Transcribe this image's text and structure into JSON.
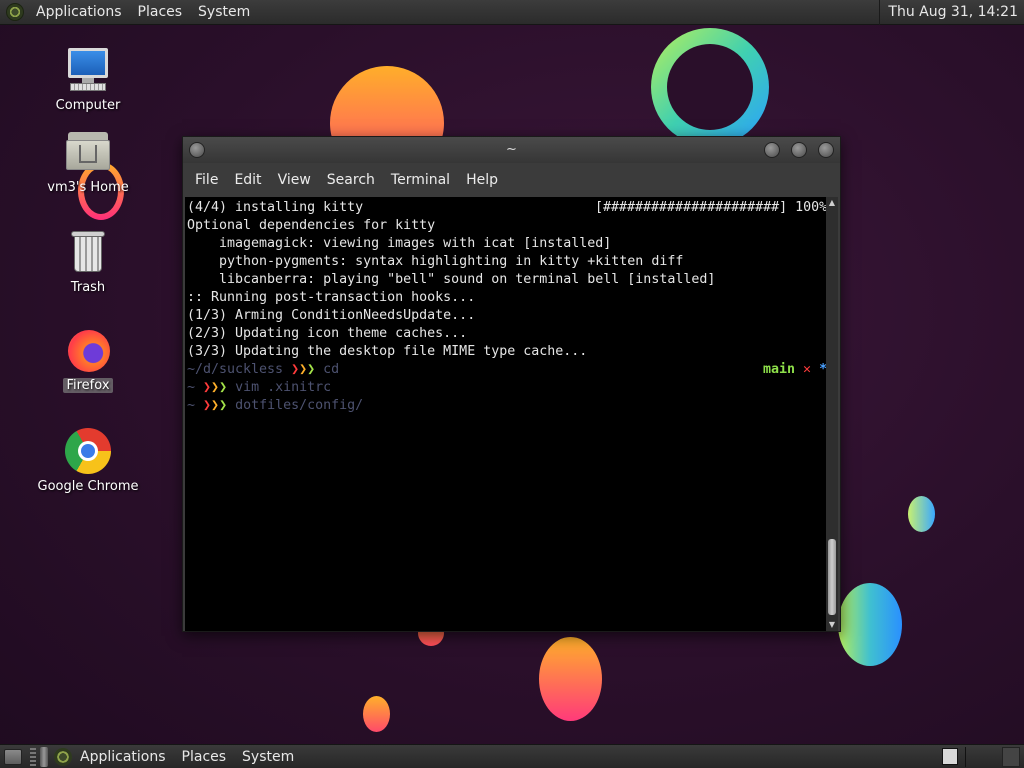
{
  "top_panel": {
    "menu": [
      "Applications",
      "Places",
      "System"
    ],
    "clock": "Thu Aug 31, 14:21"
  },
  "bottom_panel": {
    "menu": [
      "Applications",
      "Places",
      "System"
    ]
  },
  "desktop_icons": [
    {
      "label": "Computer",
      "icon": "computer-icon"
    },
    {
      "label": "vm3's Home",
      "icon": "home-folder-icon"
    },
    {
      "label": "Trash",
      "icon": "trash-icon"
    },
    {
      "label": "Firefox",
      "icon": "firefox-icon",
      "selected": true
    },
    {
      "label": "Google Chrome",
      "icon": "chrome-icon"
    }
  ],
  "terminal": {
    "title": "~",
    "menu": [
      "File",
      "Edit",
      "View",
      "Search",
      "Terminal",
      "Help"
    ],
    "lines": [
      "(4/4) installing kitty",
      "Optional dependencies for kitty",
      "    imagemagick: viewing images with icat [installed]",
      "    python-pygments: syntax highlighting in kitty +kitten diff",
      "    libcanberra: playing \"bell\" sound on terminal bell [installed]",
      ":: Running post-transaction hooks...",
      "(1/3) Arming ConditionNeedsUpdate...",
      "(2/3) Updating icon theme caches...",
      "(3/3) Updating the desktop file MIME type cache..."
    ],
    "progress": "[######################] 100%",
    "progress_value": 100,
    "prompts": [
      {
        "path": "~/d/suckless",
        "command": "cd"
      },
      {
        "path": "~",
        "command": "vim .xinitrc"
      },
      {
        "path": "~",
        "command": "dotfiles/config/"
      }
    ],
    "prompt_symbol": "❯",
    "git": {
      "branch": "main",
      "dirty_mark": "✕",
      "star": "*"
    }
  },
  "colors": {
    "chevron_red": "#ff3b3b",
    "chevron_orange": "#ffb02a",
    "chevron_green": "#a4e34a",
    "git_branch": "#8ee04a",
    "git_star": "#4aa0ff"
  }
}
